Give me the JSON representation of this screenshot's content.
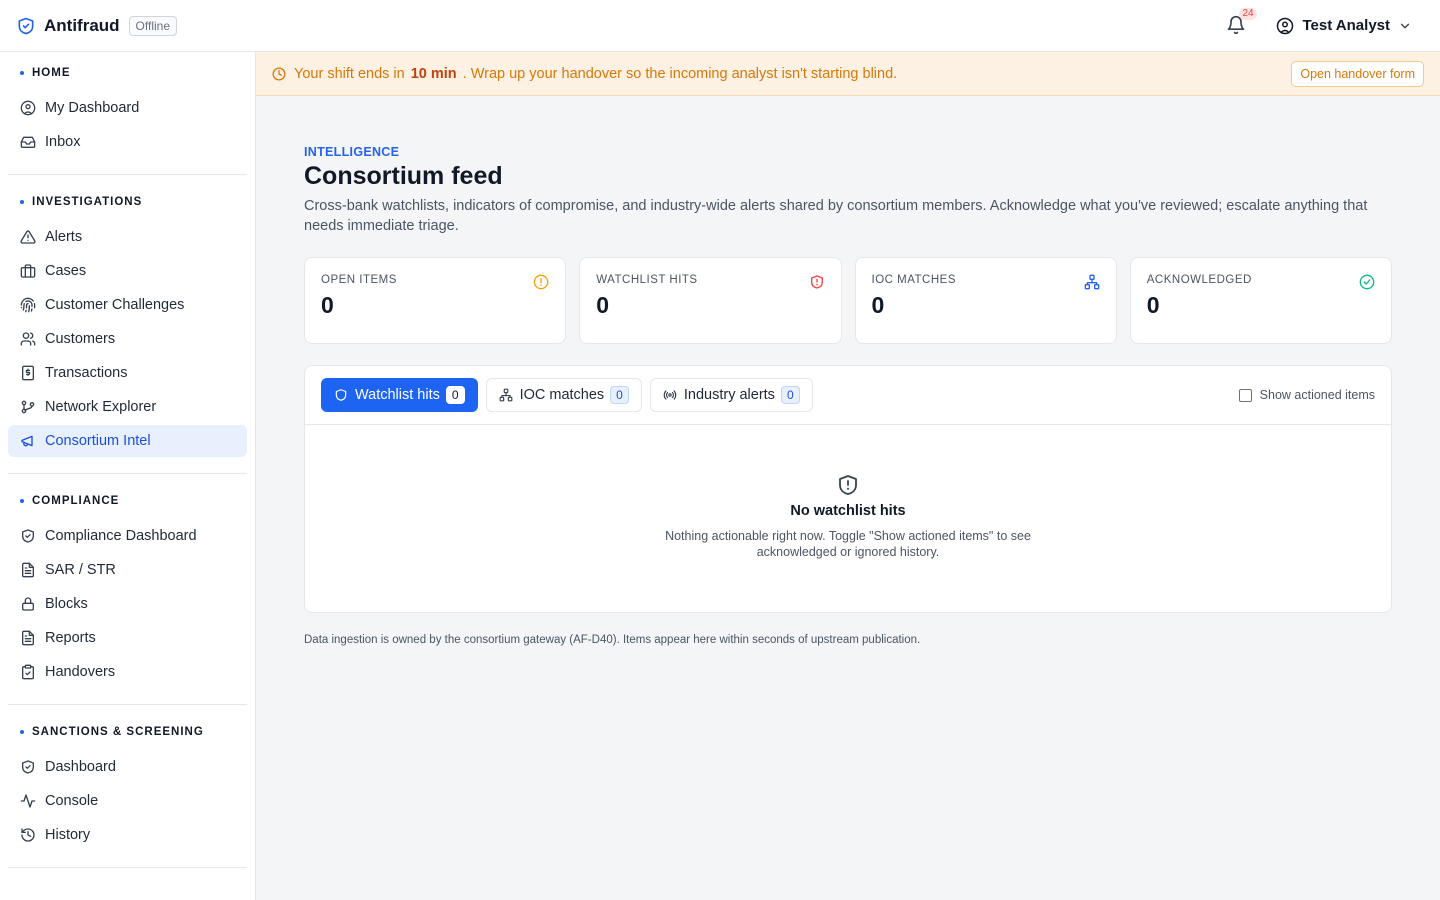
{
  "app": {
    "name": "Antifraud",
    "status": "Offline"
  },
  "header": {
    "notifications_count": "24",
    "user_name": "Test Analyst"
  },
  "sidebar": {
    "sections": [
      {
        "title": "HOME",
        "items": [
          {
            "label": "My Dashboard",
            "icon": "user-circle-icon"
          },
          {
            "label": "Inbox",
            "icon": "inbox-icon"
          }
        ]
      },
      {
        "title": "INVESTIGATIONS",
        "items": [
          {
            "label": "Alerts",
            "icon": "warning-triangle-icon"
          },
          {
            "label": "Cases",
            "icon": "briefcase-icon"
          },
          {
            "label": "Customer Challenges",
            "icon": "fingerprint-icon"
          },
          {
            "label": "Customers",
            "icon": "users-icon"
          },
          {
            "label": "Transactions",
            "icon": "receipt-icon"
          },
          {
            "label": "Network Explorer",
            "icon": "git-branch-icon"
          },
          {
            "label": "Consortium Intel",
            "icon": "megaphone-icon",
            "active": true
          }
        ]
      },
      {
        "title": "COMPLIANCE",
        "items": [
          {
            "label": "Compliance Dashboard",
            "icon": "shield-check-icon"
          },
          {
            "label": "SAR / STR",
            "icon": "document-icon"
          },
          {
            "label": "Blocks",
            "icon": "lock-icon"
          },
          {
            "label": "Reports",
            "icon": "document-icon"
          },
          {
            "label": "Handovers",
            "icon": "clipboard-check-icon"
          }
        ]
      },
      {
        "title": "SANCTIONS & SCREENING",
        "items": [
          {
            "label": "Dashboard",
            "icon": "shield-check-icon"
          },
          {
            "label": "Console",
            "icon": "activity-icon"
          },
          {
            "label": "History",
            "icon": "history-icon"
          }
        ]
      }
    ]
  },
  "banner": {
    "prefix": "Your shift ends in",
    "time": "10 min",
    "suffix": ". Wrap up your handover so the incoming analyst isn't starting blind.",
    "button": "Open handover form"
  },
  "page": {
    "eyebrow": "INTELLIGENCE",
    "title": "Consortium feed",
    "description": "Cross-bank watchlists, indicators of compromise, and industry-wide alerts shared by consortium members. Acknowledge what you've reviewed; escalate anything that needs immediate triage."
  },
  "stats": [
    {
      "label": "OPEN ITEMS",
      "value": "0",
      "icon": "alert-circle-icon",
      "color": "#f59e0b"
    },
    {
      "label": "WATCHLIST HITS",
      "value": "0",
      "icon": "shield-alert-icon",
      "color": "#ef4444"
    },
    {
      "label": "IOC MATCHES",
      "value": "0",
      "icon": "network-icon",
      "color": "#2563eb"
    },
    {
      "label": "ACKNOWLEDGED",
      "value": "0",
      "icon": "check-circle-icon",
      "color": "#10b981"
    }
  ],
  "tabs": [
    {
      "label": "Watchlist hits",
      "count": "0",
      "icon": "shield-icon",
      "active": true
    },
    {
      "label": "IOC matches",
      "count": "0",
      "icon": "network-icon"
    },
    {
      "label": "Industry alerts",
      "count": "0",
      "icon": "broadcast-icon"
    }
  ],
  "toggle": {
    "label": "Show actioned items",
    "checked": false
  },
  "empty": {
    "title": "No watchlist hits",
    "description": "Nothing actionable right now. Toggle \"Show actioned items\" to see acknowledged or ignored history."
  },
  "footnote": "Data ingestion is owned by the consortium gateway (AF-D40). Items appear here within seconds of upstream publication.",
  "colors": {
    "accent": "#1d64f2",
    "banner_bg": "#fdf1e3",
    "banner_text": "#d97706"
  }
}
